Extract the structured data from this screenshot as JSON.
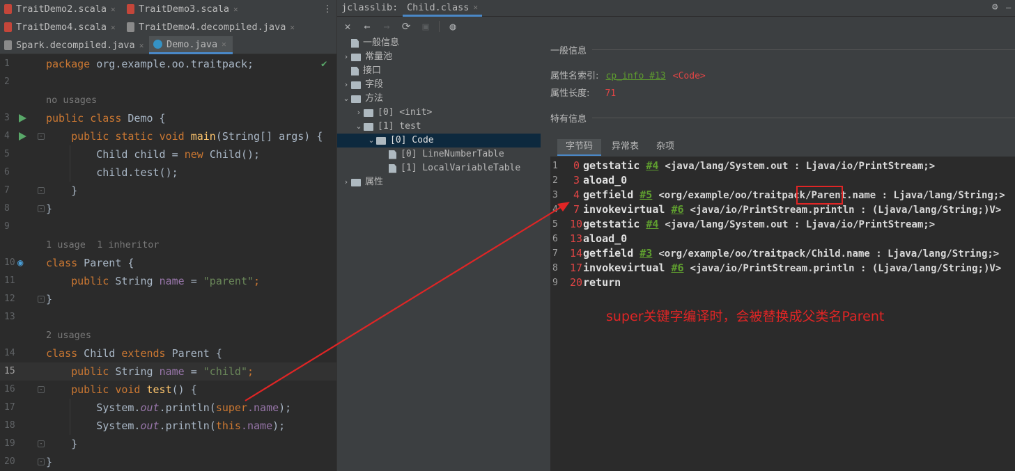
{
  "left_tabs": [
    {
      "label": "TraitDemo2.scala",
      "icon": "scala-file-icon"
    },
    {
      "label": "TraitDemo3.scala",
      "icon": "scala-file-icon"
    },
    {
      "label": "TraitDemo4.scala",
      "icon": "scala-file-icon"
    },
    {
      "label": "TraitDemo4.decompiled.java",
      "icon": "java-file-icon"
    },
    {
      "label": "Spark.decompiled.java",
      "icon": "java-file-icon"
    },
    {
      "label": "Demo.java",
      "icon": "java-class-icon",
      "active": true
    }
  ],
  "tab_menu_glyph": "⋮",
  "right_tab_title": "jclasslib:",
  "right_tab_file": "Child.class",
  "code_hints": {
    "no_usages": "no usages",
    "usage_inheritor": "1 usage  1 inheritor",
    "two_usages": "2 usages"
  },
  "line_numbers": [
    "1",
    "2",
    "3",
    "4",
    "5",
    "6",
    "7",
    "8",
    "9",
    "10",
    "11",
    "12",
    "13",
    "14",
    "15",
    "16",
    "17",
    "18",
    "19",
    "20"
  ],
  "code_tokens": {
    "package": "package",
    "pkg_name": " org.example.oo.traitpack;",
    "public": "public",
    "class": "class",
    "static": "static",
    "void": "void",
    "new": "new",
    "extends": "extends",
    "demo": " Demo {",
    "main": "main",
    "main_args": "(String[] args) {",
    "child_decl": "Child child = ",
    "child_ctor": "Child();",
    "child_test": "child.test();",
    "close_inner": "}",
    "close_outer": "}",
    "parent_decl": " Parent {",
    "string": " String ",
    "name": "name",
    "eq": " = ",
    "parent_str": "\"parent\"",
    "semi": ";",
    "child_class": " Child ",
    "parent_ref": " Parent {",
    "child_str": "\"child\"",
    "test": "test",
    "test_paren": "() {",
    "sys": "System.",
    "out": "out",
    ".println(": ".println(",
    "super": "super",
    "this": "this",
    "dot_name": ".name",
    "close_paren": ");"
  },
  "tree": [
    {
      "label": "一般信息",
      "type": "doc",
      "depth": 0
    },
    {
      "label": "常量池",
      "type": "folder",
      "depth": 0,
      "arrow": "›"
    },
    {
      "label": "接口",
      "type": "doc",
      "depth": 0
    },
    {
      "label": "字段",
      "type": "folder",
      "depth": 0,
      "arrow": "›"
    },
    {
      "label": "方法",
      "type": "folder",
      "depth": 0,
      "arrow": "⌄"
    },
    {
      "label": "[0] <init>",
      "type": "folder",
      "depth": 1,
      "arrow": "›"
    },
    {
      "label": "[1] test",
      "type": "folder",
      "depth": 1,
      "arrow": "⌄"
    },
    {
      "label": "[0] Code",
      "type": "folder",
      "depth": 2,
      "arrow": "⌄",
      "selected": true
    },
    {
      "label": "[0] LineNumberTable",
      "type": "doc",
      "depth": 3
    },
    {
      "label": "[1] LocalVariableTable",
      "type": "doc",
      "depth": 3
    },
    {
      "label": "属性",
      "type": "folder",
      "depth": 0,
      "arrow": "›"
    }
  ],
  "detail": {
    "general_header": "一般信息",
    "name_index_label": "属性名索引:",
    "name_index_link": "cp_info #13",
    "name_index_value": "<Code>",
    "length_label": "属性长度:",
    "length_value": "71",
    "specific_header": "特有信息",
    "subtabs": [
      "字节码",
      "异常表",
      "杂项"
    ]
  },
  "bytecode": [
    {
      "ln": "1",
      "off": "0",
      "op": "getstatic",
      "ref": "#4",
      "desc": "<java/lang/System.out : Ljava/io/PrintStream;>"
    },
    {
      "ln": "2",
      "off": "3",
      "op": "aload_0",
      "ref": "",
      "desc": ""
    },
    {
      "ln": "3",
      "off": "4",
      "op": "getfield",
      "ref": "#5",
      "desc": "<org/example/oo/traitpack/Parent.name : Ljava/lang/String;>"
    },
    {
      "ln": "4",
      "off": "7",
      "op": "invokevirtual",
      "ref": "#6",
      "desc": "<java/io/PrintStream.println : (Ljava/lang/String;)V>"
    },
    {
      "ln": "5",
      "off": "10",
      "op": "getstatic",
      "ref": "#4",
      "desc": "<java/lang/System.out : Ljava/io/PrintStream;>"
    },
    {
      "ln": "6",
      "off": "13",
      "op": "aload_0",
      "ref": "",
      "desc": ""
    },
    {
      "ln": "7",
      "off": "14",
      "op": "getfield",
      "ref": "#3",
      "desc": "<org/example/oo/traitpack/Child.name : Ljava/lang/String;>"
    },
    {
      "ln": "8",
      "off": "17",
      "op": "invokevirtual",
      "ref": "#6",
      "desc": "<java/io/PrintStream.println : (Ljava/lang/String;)V>"
    },
    {
      "ln": "9",
      "off": "20",
      "op": "return",
      "ref": "",
      "desc": ""
    }
  ],
  "annotation": "super关键字编译时，会被替换成父类名Parent",
  "colors": {
    "annotation": "#e02525",
    "keyword": "#cc7832",
    "string": "#6a8759",
    "field": "#9876aa",
    "function": "#ffc66d",
    "link": "#5f9e2f"
  }
}
